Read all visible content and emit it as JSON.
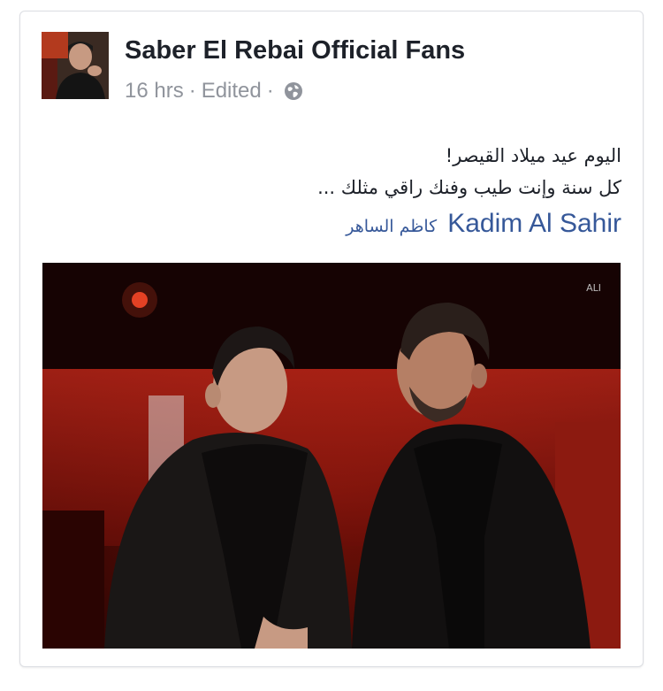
{
  "post": {
    "page_name": "Saber El Rebai Official Fans",
    "time": "16 hrs",
    "separator": "·",
    "edited": "Edited",
    "privacy_icon": "globe-icon",
    "text_line1": "اليوم عيد ميلاد القيصر!",
    "text_line2": "كل سنة وإنت طيب وفنك راقي مثلك ...",
    "tag_en": "Kadim Al Sahir",
    "tag_ar": "كاظم الساهر",
    "watermark": "ALI"
  },
  "colors": {
    "link": "#365899",
    "meta": "#90949c",
    "text": "#1d2129"
  }
}
